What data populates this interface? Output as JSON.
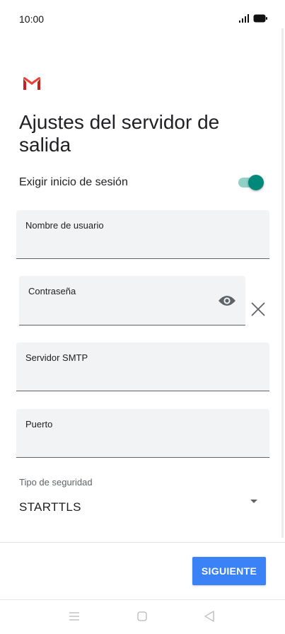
{
  "status_bar": {
    "time": "10:00",
    "icons": [
      "signal-icon",
      "battery-icon"
    ]
  },
  "app": {
    "logo": "gmail-logo",
    "brand_colors": {
      "red": "#d93025",
      "teal": "#00897b",
      "blue": "#3b82f6"
    }
  },
  "page": {
    "title": "Ajustes del servidor de salida"
  },
  "login_toggle": {
    "label": "Exigir inicio de sesión",
    "on": true
  },
  "fields": {
    "username": {
      "label": "Nombre de usuario",
      "value": ""
    },
    "password": {
      "label": "Contraseña",
      "value": "",
      "icons": [
        "eye-icon",
        "clear-icon"
      ]
    },
    "smtp": {
      "label": "Servidor SMTP",
      "value": ""
    },
    "port": {
      "label": "Puerto",
      "value": ""
    }
  },
  "security": {
    "label": "Tipo de seguridad",
    "selected": "STARTTLS"
  },
  "actions": {
    "next_label": "SIGUIENTE"
  },
  "nav": {
    "icons": [
      "menu-icon",
      "home-icon",
      "back-icon"
    ]
  }
}
